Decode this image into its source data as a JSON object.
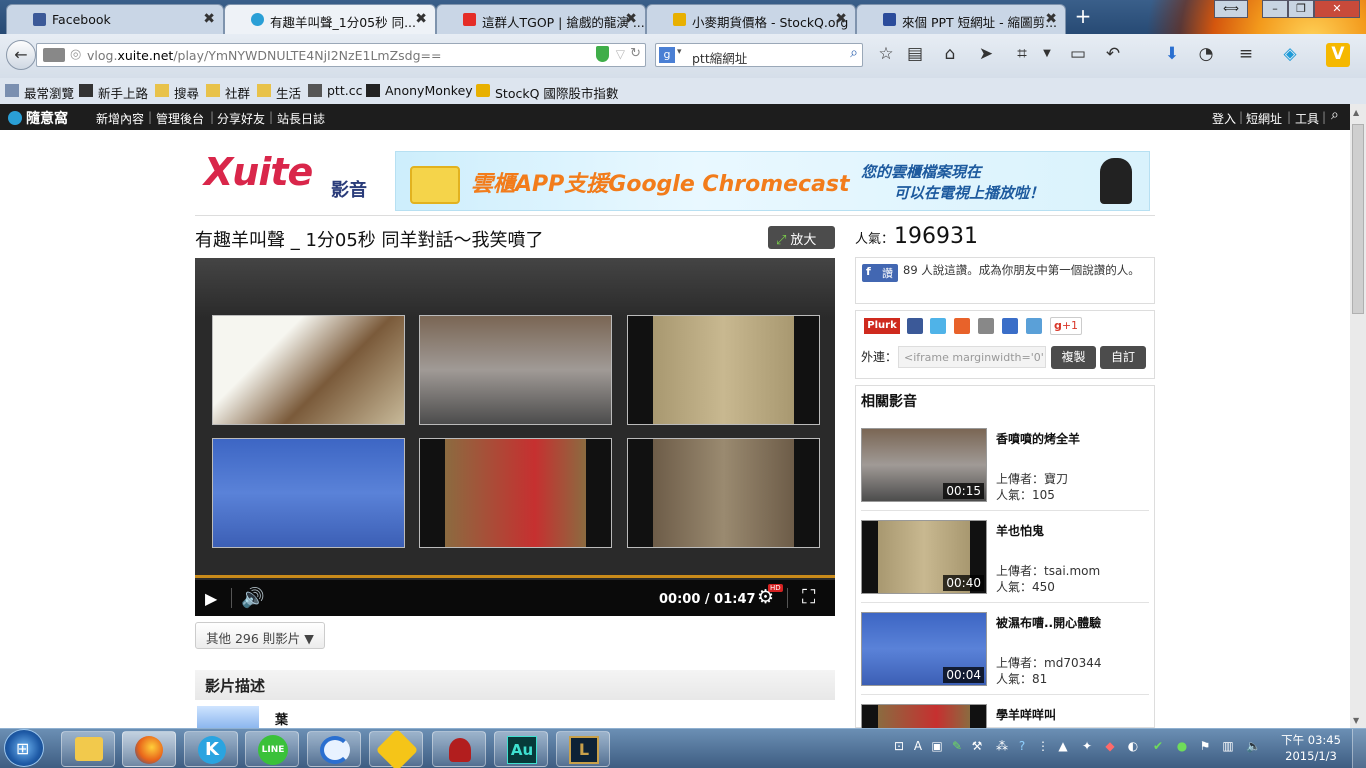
{
  "browser": {
    "tabs": [
      {
        "label": "Facebook",
        "color": "#3b5998"
      },
      {
        "label": "有趣羊叫聲_1分05秒 同...",
        "color": "#2a9fd6"
      },
      {
        "label": "這群人TGOP | 搶戲的龍演 ...",
        "color": "#e52d27"
      },
      {
        "label": "小麥期貨價格 - StockQ.org",
        "color": "#e8b000"
      },
      {
        "label": "來個 PPT 短網址 - 縮圖剪...",
        "color": "#2b4c9b"
      }
    ],
    "new_tab": "+",
    "url_prefix": "vlog.",
    "url_domain": "xuite.net",
    "url_path": "/play/YmNYWDNULTE4NjI2NzE1LmZsdg==",
    "search_value": "ptt縮網址",
    "bookmarks": [
      "最常瀏覽",
      "新手上路",
      "搜尋",
      "社群",
      "生活",
      "ptt.cc",
      "AnonyMonkey",
      "StockQ 國際股市指數"
    ]
  },
  "sitebar": {
    "logo": "隨意窩",
    "links": [
      "新增內容",
      "管理後台",
      "分享好友",
      "站長日誌"
    ],
    "right_links": [
      "登入",
      "短網址",
      "工具"
    ]
  },
  "header": {
    "logo_text": "Xuite",
    "logo_sub": "影音",
    "ad_main": "雲櫃APP支援Google Chromecast",
    "ad_side_1": "您的雲櫃檔案現在",
    "ad_side_2": "可以在電視上播放啦！"
  },
  "video": {
    "title": "有趣羊叫聲 _ 1分05秒 同羊對話～我笑噴了",
    "zoom_label": "放大",
    "time": "00:00 / 01:47",
    "hd": "HD",
    "progress": 0,
    "more_videos": "其他 296 則影片 ▼",
    "description_title": "影片描述",
    "uploader_short": "葉"
  },
  "sidebar": {
    "views_label": "人氣：",
    "views": "196931",
    "fb_label": "讚",
    "fb_text": "89 人說這讚。成為你朋友中第一個說讚的人。",
    "plurk": "Plurk",
    "gplus": "+1",
    "embed_label": "外連：",
    "embed_value": "<iframe marginwidth='0' m",
    "copy_btn": "複製",
    "custom_btn": "自訂",
    "related_title": "相關影音",
    "related": [
      {
        "title": "香噴噴的烤全羊",
        "uploader_label": "上傳者：",
        "uploader": "寶刀",
        "views_label": "人氣：",
        "views": "105",
        "duration": "00:15"
      },
      {
        "title": "羊也怕鬼",
        "uploader_label": "上傳者：",
        "uploader": "tsai.mom",
        "views_label": "人氣：",
        "views": "450",
        "duration": "00:40"
      },
      {
        "title": "被濕布嘈..開心體驗",
        "uploader_label": "上傳者：",
        "uploader": "md70344",
        "views_label": "人氣：",
        "views": "81",
        "duration": "00:04"
      },
      {
        "title": "學羊咩咩叫",
        "uploader_label": "",
        "uploader": "",
        "views_label": "",
        "views": "",
        "duration": ""
      }
    ]
  },
  "taskbar": {
    "clock_time": "下午 03:45",
    "clock_date": "2015/1/3",
    "au_label": "Au"
  }
}
